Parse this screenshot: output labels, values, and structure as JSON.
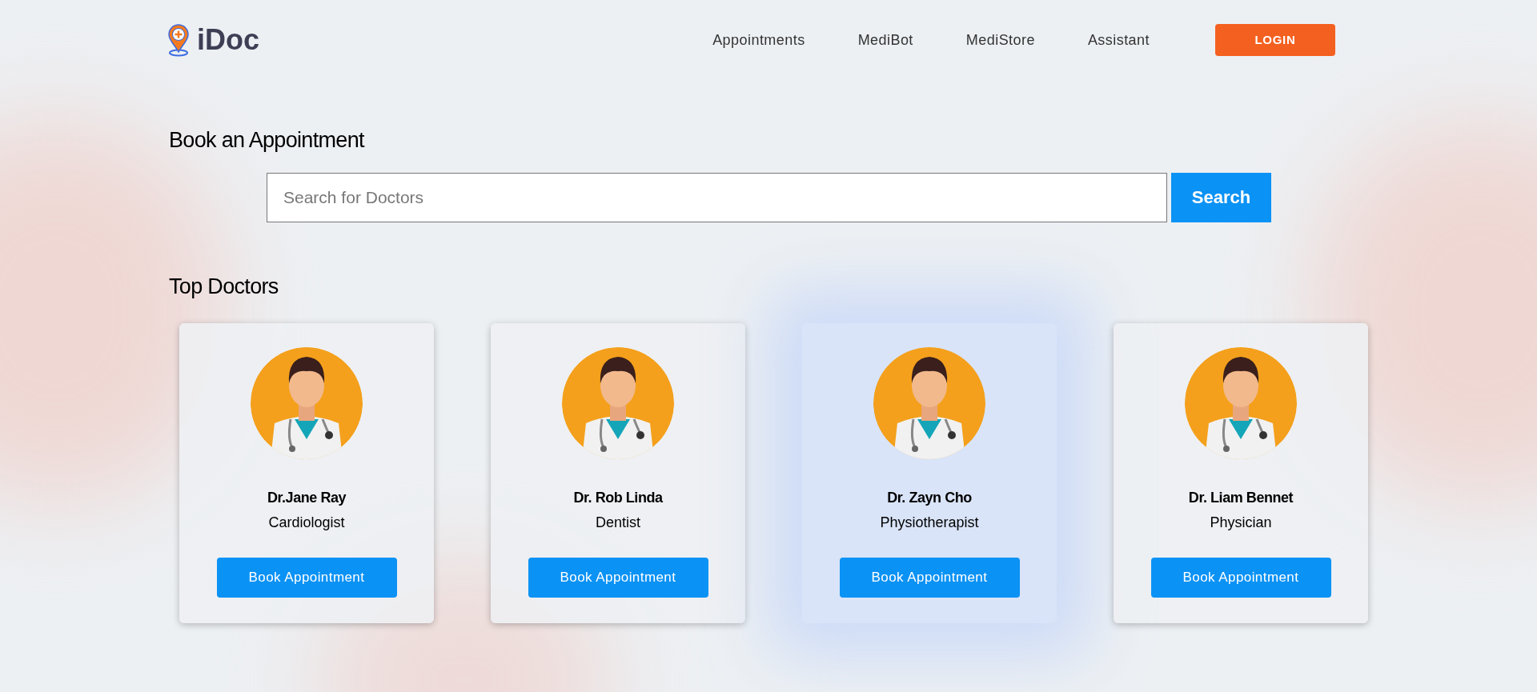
{
  "logo": {
    "text": "iDoc"
  },
  "nav": [
    {
      "label": "Appointments"
    },
    {
      "label": "MediBot"
    },
    {
      "label": "MediStore"
    },
    {
      "label": "Assistant"
    }
  ],
  "login_button": "LOGIN",
  "booking": {
    "heading": "Book an Appointment",
    "search": {
      "placeholder": "Search for Doctors"
    },
    "search_button": "Search"
  },
  "top_doctors": {
    "heading": "Top Doctors",
    "doctors": [
      {
        "name": "Dr.Jane Ray",
        "specialty": "Cardiologist",
        "button": "Book Appointment",
        "highlighted": false
      },
      {
        "name": "Dr. Rob Linda",
        "specialty": "Dentist",
        "button": "Book Appointment",
        "highlighted": false
      },
      {
        "name": "Dr. Zayn Cho",
        "specialty": "Physiotherapist",
        "button": "Book Appointment",
        "highlighted": true
      },
      {
        "name": "Dr. Liam Bennet",
        "specialty": "Physician",
        "button": "Book Appointment",
        "highlighted": false
      }
    ]
  }
}
